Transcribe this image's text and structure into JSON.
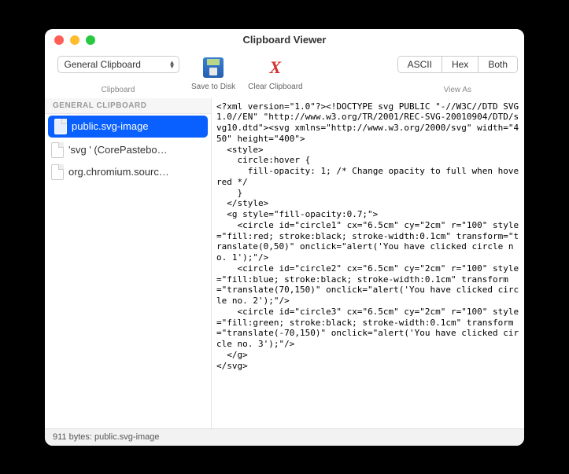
{
  "window": {
    "title": "Clipboard Viewer"
  },
  "toolbar": {
    "clipboard_dropdown": "General Clipboard",
    "clipboard_label": "Clipboard",
    "save_label": "Save to Disk",
    "clear_label": "Clear Clipboard",
    "view_segments": {
      "ascii": "ASCII",
      "hex": "Hex",
      "both": "Both"
    },
    "view_as_label": "View As"
  },
  "sidebar": {
    "header": "GENERAL CLIPBOARD",
    "items": [
      {
        "label": "public.svg-image",
        "selected": true
      },
      {
        "label": "'svg ' (CorePastebo…",
        "selected": false
      },
      {
        "label": "org.chromium.sourc…",
        "selected": false
      }
    ]
  },
  "content": {
    "text": "<?xml version=\"1.0\"?><!DOCTYPE svg PUBLIC \"-//W3C//DTD SVG 1.0//EN\" \"http://www.w3.org/TR/2001/REC-SVG-20010904/DTD/svg10.dtd\"><svg xmlns=\"http://www.w3.org/2000/svg\" width=\"450\" height=\"400\">\n  <style>\n    circle:hover {\n      fill-opacity: 1; /* Change opacity to full when hovered */\n    }\n  </style>\n  <g style=\"fill-opacity:0.7;\">\n    <circle id=\"circle1\" cx=\"6.5cm\" cy=\"2cm\" r=\"100\" style=\"fill:red; stroke:black; stroke-width:0.1cm\" transform=\"translate(0,50)\" onclick=\"alert('You have clicked circle no. 1');\"/>\n    <circle id=\"circle2\" cx=\"6.5cm\" cy=\"2cm\" r=\"100\" style=\"fill:blue; stroke:black; stroke-width:0.1cm\" transform=\"translate(70,150)\" onclick=\"alert('You have clicked circle no. 2');\"/>\n    <circle id=\"circle3\" cx=\"6.5cm\" cy=\"2cm\" r=\"100\" style=\"fill:green; stroke:black; stroke-width:0.1cm\" transform=\"translate(-70,150)\" onclick=\"alert('You have clicked circle no. 3');\"/>\n  </g>\n</svg>"
  },
  "status": {
    "text": "911 bytes: public.svg-image"
  }
}
